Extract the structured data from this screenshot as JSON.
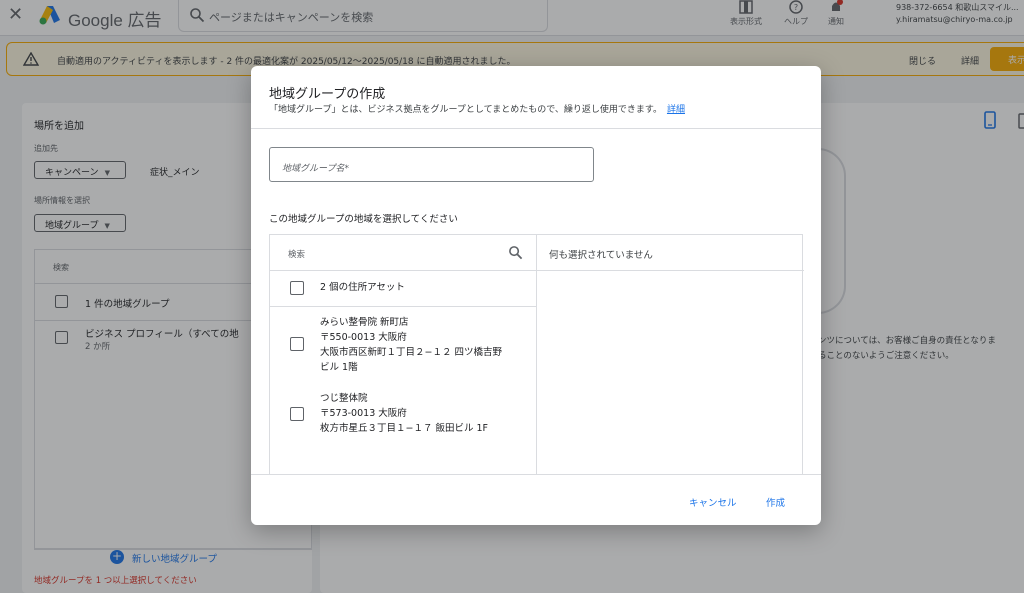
{
  "topbar": {
    "brand": "Google 広告",
    "search_placeholder": "ページまたはキャンペーンを検索",
    "nav": [
      {
        "label": "表示形式",
        "icon": "appearance-icon"
      },
      {
        "label": "ヘルプ",
        "icon": "help-icon"
      },
      {
        "label": "通知",
        "icon": "bell-icon"
      }
    ],
    "account_line1": "938-372-6654 和歌山スマイル...",
    "account_line2": "y.hiramatsu@chiryo-ma.co.jp"
  },
  "banner": {
    "message": "自動適用のアクティビティを表示します - 2 件の最適化案が 2025/05/12～2025/05/18 に自動適用されました。",
    "close_label": "閉じる",
    "detail_label": "詳細",
    "show_label": "表示"
  },
  "left_panel": {
    "title": "場所を追加",
    "add_to_label": "追加先",
    "campaign_dropdown": "キャンペーン",
    "campaign_name": "症状_メイン",
    "location_info_label": "場所情報を選択",
    "location_group_dropdown": "地域グループ",
    "search_label": "検索",
    "rows": [
      {
        "label": "1 件の地域グループ",
        "sub": ""
      },
      {
        "label": "ビジネス プロフィール（すべての地",
        "sub": "2 か所"
      }
    ],
    "new_group_label": "新しい地域グループ",
    "error_text": "地域グループを 1 つ以上選択してください"
  },
  "right_panel": {
    "note_line1": "ンツについては、お客様ご自身の責任となりま",
    "note_line2": "ることのないようご注意ください。"
  },
  "dialog": {
    "title": "地域グループの作成",
    "description": "「地域グループ」とは、ビジネス拠点をグループとしてまとめたもので、繰り返し使用できます。",
    "detail_link": "詳細",
    "name_placeholder": "地域グループ名*",
    "select_label": "この地域グループの地域を選択してください",
    "search_label": "検索",
    "none_selected": "何も選択されていません",
    "header_row": "2 個の住所アセット",
    "locations": [
      {
        "name": "みらい整骨院 新町店",
        "postal": "〒550-0013 大阪府",
        "address1": "大阪市西区新町１丁目２−１２ 四ツ橋吉野",
        "address2": "ビル 1階"
      },
      {
        "name": "つじ整体院",
        "postal": "〒573-0013 大阪府",
        "address1": "枚方市星丘３丁目１−１７ 飯田ビル 1F",
        "address2": ""
      }
    ],
    "cancel_label": "キャンセル",
    "create_label": "作成"
  }
}
